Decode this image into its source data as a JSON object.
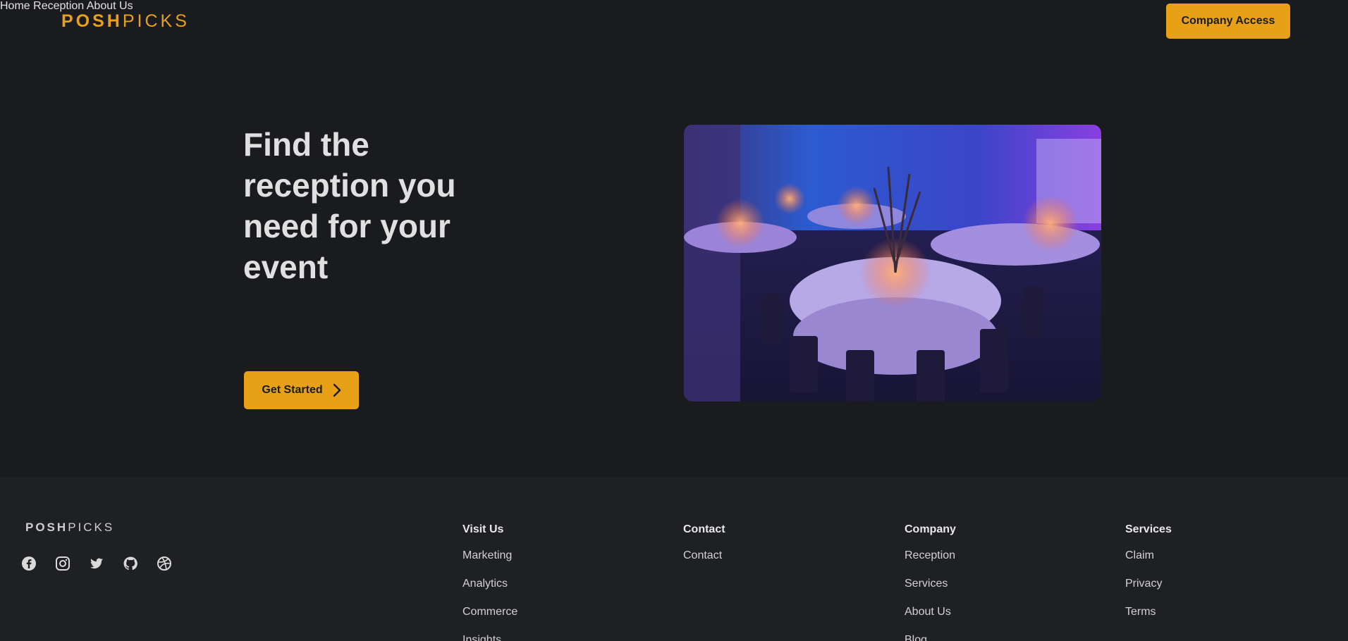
{
  "brand": {
    "logo_bold": "POSH",
    "logo_light": "PICKS"
  },
  "nav": {
    "items": [
      {
        "label": "Home",
        "active": true
      },
      {
        "label": "Reception",
        "active": false
      },
      {
        "label": "About Us",
        "active": false
      }
    ],
    "cta": "Company Access"
  },
  "hero": {
    "title": "Find the reception you need for your event",
    "button": "Get Started"
  },
  "footer": {
    "logo_bold": "POSH",
    "logo_light": "PICKS",
    "socials": [
      "facebook-icon",
      "instagram-icon",
      "twitter-icon",
      "github-icon",
      "dribbble-icon"
    ],
    "columns": [
      {
        "heading": "Visit Us",
        "links": [
          "Marketing",
          "Analytics",
          "Commerce",
          "Insights"
        ]
      },
      {
        "heading": "Contact",
        "links": [
          "Contact"
        ]
      },
      {
        "heading": "Company",
        "links": [
          "Reception",
          "Services",
          "About Us",
          "Blog"
        ]
      },
      {
        "heading": "Services",
        "links": [
          "Claim",
          "Privacy",
          "Terms"
        ]
      }
    ]
  },
  "colors": {
    "accent": "#e8a116",
    "background": "#1a1b1e",
    "footer": "#1f2023"
  }
}
